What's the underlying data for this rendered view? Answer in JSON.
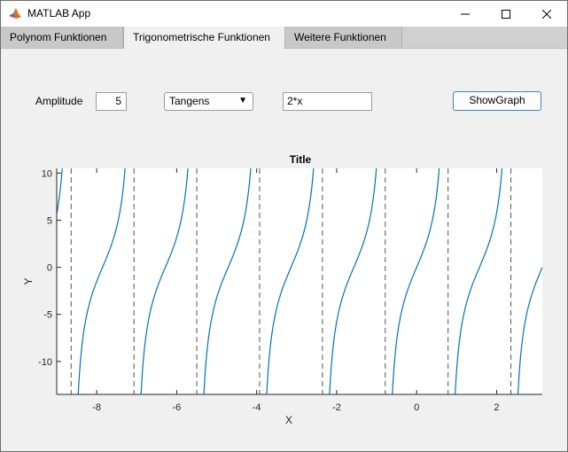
{
  "window": {
    "title": "MATLAB App",
    "icon": "matlab-icon"
  },
  "tabs": [
    {
      "label": "Polynom Funktionen",
      "active": false
    },
    {
      "label": "Trigonometrische Funktionen",
      "active": true
    },
    {
      "label": "Weitere Funktionen",
      "active": false
    }
  ],
  "controls": {
    "amplitude_label": "Amplitude",
    "amplitude_value": "5",
    "function_selected": "Tangens",
    "expression": "2*x",
    "show_graph_label": "ShowGraph"
  },
  "chart_data": {
    "type": "line",
    "title": "Title",
    "xlabel": "X",
    "ylabel": "Y",
    "xlim": [
      -9,
      3.1416
    ],
    "ylim": [
      -13.5,
      10.5
    ],
    "xticks": [
      -8,
      -6,
      -4,
      -2,
      0,
      2
    ],
    "yticks": [
      -10,
      -5,
      0,
      5,
      10
    ],
    "grid": false,
    "series": [
      {
        "expression": "5*tan(2*x)",
        "color": "#0072bd"
      }
    ],
    "asymptotes": [
      -8.6394,
      -7.0686,
      -5.4978,
      -3.927,
      -2.3562,
      -0.7854,
      0.7854,
      2.3562
    ],
    "asymptote_color": "#555555"
  }
}
